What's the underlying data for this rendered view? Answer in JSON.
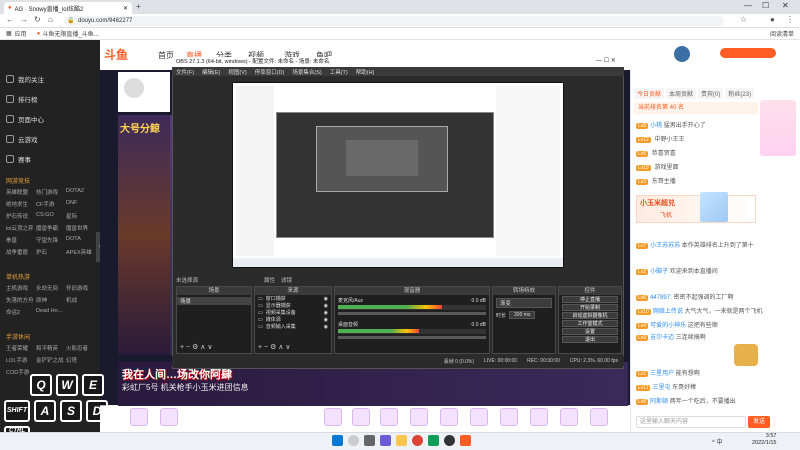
{
  "browser": {
    "tab_title": "AG · Snowy直播_lol炫酷2",
    "url": "douyu.com/9462277",
    "bookmarks": [
      "应用",
      "斗鱼无限直播_斗鱼..."
    ],
    "reading_list": "阅读清单"
  },
  "site": {
    "logo": "斗鱼",
    "nav": [
      "首页",
      "直播",
      "分类",
      "视频",
      "游戏",
      "鱼吧"
    ],
    "nav_active_index": 1
  },
  "sidebar": {
    "items": [
      "我的关注",
      "排行榜",
      "页面中心",
      "云游戏",
      "赛事"
    ],
    "categories": [
      {
        "title": "网游竞技",
        "games": [
          "英雄联盟",
          "热门游戏",
          "DOTA2",
          "绝地求生",
          "CF手游",
          "DNF",
          "炉石传说",
          "CS:GO",
          "星际",
          "lol云顶之弈",
          "魔兽争霸",
          "魔兽世界",
          "拳皇",
          "守望先锋",
          "DOTA",
          "战争雷霆",
          "炉石",
          "APEX英雄"
        ]
      },
      {
        "title": "单机热游",
        "games": [
          "主机游戏",
          "永劫无间",
          "怀旧游戏",
          "失落的方舟",
          "原神",
          "机战",
          "命运2",
          "Dead Ho..."
        ]
      },
      {
        "title": "手游休闲",
        "games": [
          "王者荣耀",
          "和平精英",
          "火影忍者",
          "LOL手游",
          "金铲铲之战",
          "幻塔",
          "COD手游",
          "",
          ""
        ]
      }
    ]
  },
  "stream": {
    "title_overlay": "大号分鲸",
    "banner_main": "我在人间…场改你阿肆",
    "banner_sub": "彩虹厂5号 机关枪手小玉米进团信息",
    "keys_row1": [
      "Q",
      "W",
      "E"
    ],
    "keys_row2": [
      "SHIFT",
      "A",
      "S",
      "D"
    ],
    "ctrl_label": "CTRL"
  },
  "obs": {
    "title": "OBS 27.1.3 (64-bit, windows) - 配置文件: 未命名 - 场景: 未命名",
    "menu": [
      "文件(F)",
      "编辑(E)",
      "视图(V)",
      "停靠窗口(D)",
      "场景集合(S)",
      "工具(T)",
      "帮助(H)"
    ],
    "hint": "未选择源",
    "tabs": [
      "属性",
      "滤镜"
    ],
    "docks": {
      "scenes": "场景",
      "sources": "来源",
      "mixer": "混音器",
      "transitions": "转场特效",
      "controls": "控件"
    },
    "scene_item": "场景",
    "sources": [
      "窗口捕获",
      "显示器捕获",
      "视频采集设备",
      "媒体源",
      "音频输入采集"
    ],
    "mixer": [
      {
        "name": "麦克风/Aux",
        "db": "0.0 dB",
        "level": 0.7
      },
      {
        "name": "桌面音频",
        "db": "0.0 dB",
        "level": 0.55
      }
    ],
    "transition": "渐变",
    "duration_label": "时长",
    "duration_value": "300 ms",
    "controls": [
      "停止直播",
      "开始录制",
      "启动虚拟摄像机",
      "工作室模式",
      "设置",
      "退出"
    ],
    "status": {
      "dropped": "丢帧 0 (0.0%)",
      "live": "LIVE: 00:00:00",
      "rec": "REC: 00:00:00",
      "cpu": "CPU: 2.3%, 60.00 fps"
    }
  },
  "chat": {
    "tabs": [
      "今日贡献",
      "本周贡献",
      "贵宾(0)",
      "粉丝(23)"
    ],
    "rank_text": "当前排名第 40 名",
    "messages": [
      {
        "level": "Lv8",
        "user": "小桃",
        "text": "猛男出手开心了"
      },
      {
        "level": "Lv12",
        "user": "",
        "text": "中野小王王"
      },
      {
        "level": "Lv5",
        "user": "",
        "text": "恭喜贺喜"
      },
      {
        "level": "Lv19",
        "user": "",
        "text": "游戏里面"
      },
      {
        "level": "Lv3",
        "user": "",
        "text": "东哥主播"
      },
      {
        "level": "Lv7",
        "user": "小王苏苏苏",
        "text": "本作英雄排名上升到了第十"
      },
      {
        "level": "Lv2",
        "user": "小脑子",
        "text": "欢迎来到本直播间"
      },
      {
        "level": "Lv6",
        "user": "447897:",
        "text": "密密不起强调的工厂啊"
      },
      {
        "level": "Lv10",
        "user": "网络上传说",
        "text": "大气大气，一来就是两个飞机"
      },
      {
        "level": "Lv4",
        "user": "可爱的小神乐",
        "text": "这把有些顺"
      },
      {
        "level": "Lv9",
        "user": "吉尔卡迈",
        "text": "三连续搞啊"
      },
      {
        "level": "Lv1",
        "user": "三星用户",
        "text": "能有想啊"
      },
      {
        "level": "Lv11",
        "user": "三里屯",
        "text": "东哥好棒"
      },
      {
        "level": "Lv8",
        "user": "阿斯顿",
        "text": "两年一个吃后，不要播出"
      }
    ],
    "promo": "小玉米超兑",
    "promo_sub": "飞机",
    "input_placeholder": "这里输入聊天内容",
    "send": "发送"
  },
  "taskbar": {
    "time": "3:57",
    "date": "2022/1/15",
    "tray": "^ 中"
  },
  "colors": {
    "brand": "#ff5d23",
    "obs_bg": "#2b2b2b",
    "sidebar_bg": "#222222"
  }
}
